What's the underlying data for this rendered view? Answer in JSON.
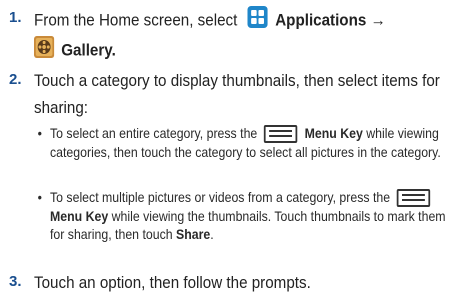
{
  "steps": [
    {
      "number": "1.",
      "line1_pre": "From the Home screen, select",
      "apps_label": "Applications",
      "arrow": "→",
      "gallery_label": "Gallery",
      "gallery_suffix": "."
    },
    {
      "number": "2.",
      "text": "Touch a category to display thumbnails, then select items for sharing:"
    },
    {
      "number": "3.",
      "text": "Touch an option, then follow the prompts."
    }
  ],
  "bullets": [
    {
      "bullet": "•",
      "pre": "To select an entire category, press the",
      "key_label": "Menu",
      "key_word": "Key",
      "post": "while viewing categories, then touch the category to select all pictures in the category."
    },
    {
      "bullet": "•",
      "pre": "To select multiple pictures or videos from a category, press the",
      "key_label": "Menu",
      "key_word": "Key",
      "post": "while viewing the thumbnails. Touch thumbnails to mark them for sharing, then touch",
      "share_label": "Share",
      "share_suffix": "."
    }
  ],
  "icons": {
    "applications": "applications-grid-icon",
    "gallery": "gallery-film-icon",
    "menu_key": "menu-key-icon"
  },
  "colors": {
    "step_number": "#1a4f8f",
    "apps_icon_bg": "#1f86c9"
  }
}
